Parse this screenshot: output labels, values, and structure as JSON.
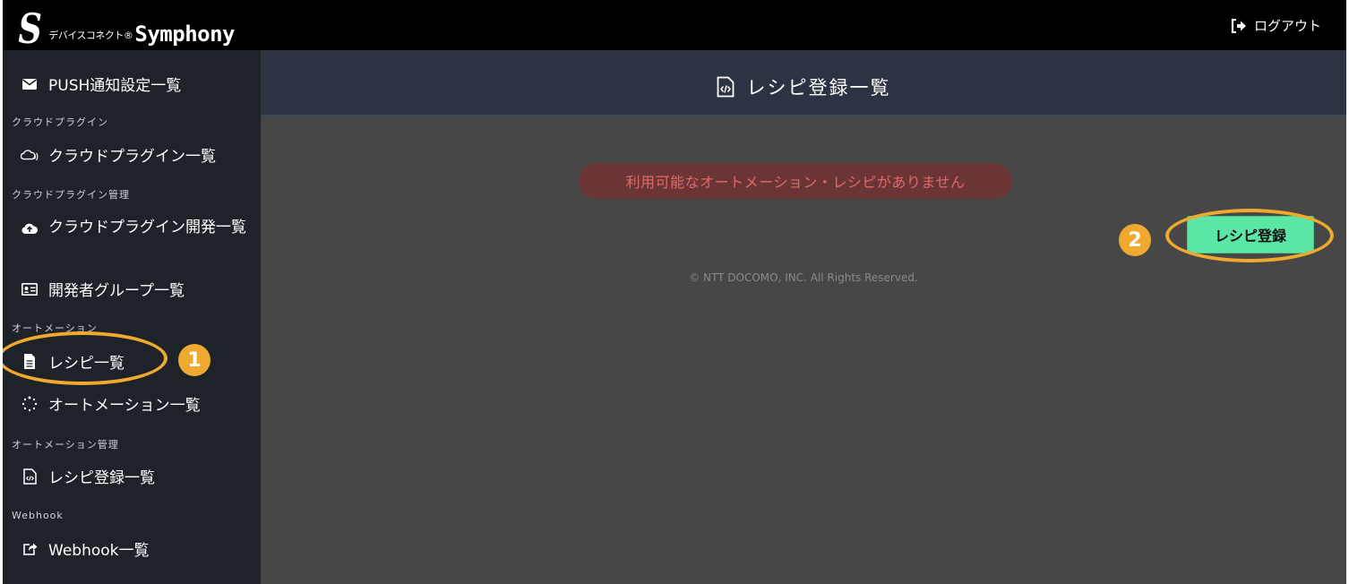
{
  "app": {
    "logo_sub": "デバイスコネクト®",
    "logo_main": "Symphony",
    "logout_label": "ログアウト"
  },
  "sidebar": {
    "push_label": "PUSH通知設定一覧",
    "section_cloud_plugin": "クラウドプラグイン",
    "cloud_plugin_list": "クラウドプラグイン一覧",
    "section_cloud_plugin_admin": "クラウドプラグイン管理",
    "cloud_plugin_dev_list": "クラウドプラグイン開発一覧",
    "developer_group_list": "開発者グループ一覧",
    "section_automation": "オートメーション",
    "recipe_list": "レシピ一覧",
    "automation_list": "オートメーション一覧",
    "section_automation_admin": "オートメーション管理",
    "recipe_register_list": "レシピ登録一覧",
    "section_webhook": "Webhook",
    "webhook_list": "Webhook一覧"
  },
  "main": {
    "title": "レシピ登録一覧",
    "empty_message": "利用可能なオートメーション・レシピがありません",
    "register_button": "レシピ登録",
    "copyright": "© NTT DOCOMO, INC. All Rights Reserved."
  },
  "annotations": {
    "step1": "1",
    "step2": "2"
  },
  "colors": {
    "sidebar_bg": "#1e2229",
    "header_bg": "#2c3443",
    "content_bg": "#474747",
    "button_green": "#5ce6a5",
    "annotation_orange": "#f0a92f",
    "error_text": "#e06a6a"
  },
  "icons": {
    "push": "envelope-icon",
    "cloud_plugin_list": "cloud-signal-icon",
    "cloud_plugin_dev": "cloud-upload-icon",
    "developer_group": "id-card-icon",
    "recipe_list": "document-icon",
    "automation_list": "spinner-icon",
    "recipe_register": "code-file-icon",
    "webhook": "share-square-icon",
    "logout": "sign-out-icon"
  }
}
